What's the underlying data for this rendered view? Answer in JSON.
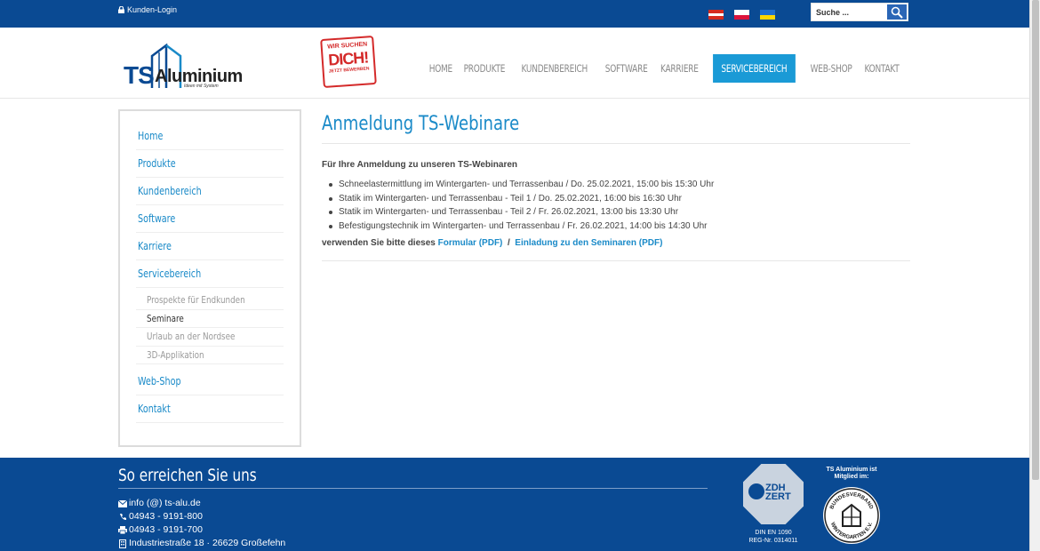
{
  "topbar": {
    "login_label": "Kunden-Login",
    "search_placeholder": "Suche ...",
    "flags": [
      "austria-flag",
      "poland-flag",
      "ukraine-flag"
    ]
  },
  "header": {
    "logo_ts": "TS",
    "logo_rest": "Aluminium",
    "logo_tagline": "Ideen mit System",
    "stamp_line1": "WIR SUCHEN",
    "stamp_line2": "DICH!",
    "stamp_line3": "JETZT BEWERBEN"
  },
  "nav": {
    "items": [
      "HOME",
      "PRODUKTE",
      "KUNDENBEREICH",
      "SOFTWARE",
      "KARRIERE",
      "SERVICEBEREICH",
      "WEB-SHOP",
      "KONTAKT"
    ],
    "active": "SERVICEBEREICH"
  },
  "sidebar": {
    "items": [
      "Home",
      "Produkte",
      "Kundenbereich",
      "Software",
      "Karriere",
      "Servicebereich"
    ],
    "subitems": [
      "Prospekte für Endkunden",
      "Seminare",
      "Urlaub an der Nordsee",
      "3D-Applikation"
    ],
    "current_sub": "Seminare",
    "items_after": [
      "Web-Shop",
      "Kontakt"
    ]
  },
  "main": {
    "title": "Anmeldung TS-Webinare",
    "intro": "Für Ihre Anmeldung zu unseren TS-Webinaren",
    "webinars": [
      "Schneelastermittlung im Wintergarten- und Terrassenbau / Do. 25.02.2021, 15:00 bis 15:30 Uhr",
      "Statik im Wintergarten- und Terrassenbau - Teil 1 / Do. 25.02.2021, 16:00 bis 16:30 Uhr",
      "Statik im Wintergarten- und Terrassenbau - Teil 2 / Fr. 26.02.2021, 13:00 bis 13:30 Uhr",
      "Befestigungstechnik im Wintergarten- und Terrassenbau / Fr. 26.02.2021, 14:00 bis 14:30 Uhr"
    ],
    "use_prefix": "verwenden Sie bitte dieses",
    "link_formular": "Formular (PDF)",
    "separator": "/",
    "link_einladung": "Einladung zu den Seminaren (PDF)"
  },
  "footer": {
    "title": "So erreichen Sie uns",
    "email": "info (@) ts-alu.de",
    "phone": "04943 - 9191-800",
    "fax": "04943 - 9191-700",
    "address": "Industriestraße 18 · 26629 Großefehn",
    "zdh_line1": "ZDH",
    "zdh_line2": "ZERT",
    "zdh_norm": "DIN EN 1090",
    "zdh_reg": "REG-Nr. 0314011",
    "member_text": "TS Aluminium ist Mitglied im:",
    "seal_top": "BUNDESVERBAND",
    "seal_bottom": "WINTERGARTEN E.V."
  },
  "colors": {
    "brand_blue": "#0a4a93",
    "accent": "#1a9ad6",
    "link": "#1a8ac8"
  }
}
